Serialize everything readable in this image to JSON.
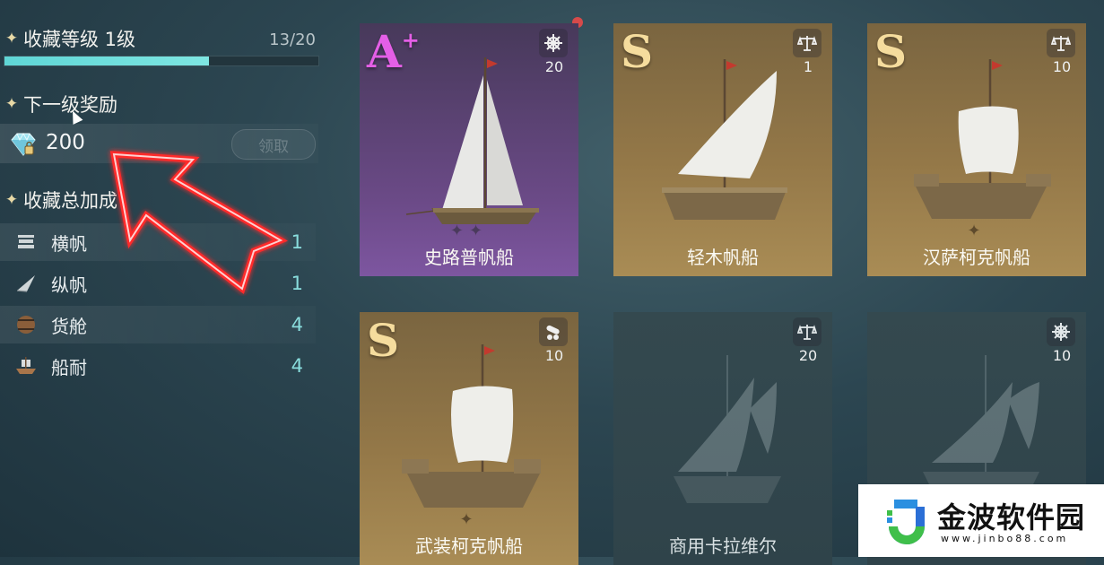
{
  "collection": {
    "level_title": "收藏等级 1级",
    "progress_text": "13/20",
    "progress_fraction": 0.65
  },
  "reward": {
    "title": "下一级奖励",
    "amount": "200",
    "claim_label": "领取"
  },
  "bonus": {
    "title": "收藏总加成",
    "items": [
      {
        "label": "横帆",
        "value": "1",
        "icon": "square-sail-icon"
      },
      {
        "label": "纵帆",
        "value": "1",
        "icon": "lateen-sail-icon"
      },
      {
        "label": "货舱",
        "value": "4",
        "icon": "barrel-icon"
      },
      {
        "label": "船耐",
        "value": "4",
        "icon": "ship-hull-icon"
      }
    ]
  },
  "ships": [
    {
      "name": "史路普帆船",
      "grade": "A",
      "grade_suffix": "+",
      "trait_icon": "helm-wheel-icon",
      "trait_value": "20",
      "rarity": "purple"
    },
    {
      "name": "轻木帆船",
      "grade": "S",
      "grade_suffix": "",
      "trait_icon": "scales-icon",
      "trait_value": "1",
      "rarity": "gold"
    },
    {
      "name": "汉萨柯克帆船",
      "grade": "S",
      "grade_suffix": "",
      "trait_icon": "scales-icon",
      "trait_value": "10",
      "rarity": "gold"
    },
    {
      "name": "武装柯克帆船",
      "grade": "S",
      "grade_suffix": "",
      "trait_icon": "cannon-icon",
      "trait_value": "10",
      "rarity": "gold"
    },
    {
      "name": "商用卡拉维尔",
      "grade": "",
      "grade_suffix": "",
      "trait_icon": "scales-icon",
      "trait_value": "20",
      "rarity": "locked"
    },
    {
      "name": "",
      "grade": "",
      "grade_suffix": "",
      "trait_icon": "helm-wheel-icon",
      "trait_value": "10",
      "rarity": "locked"
    }
  ],
  "watermark": {
    "title": "金波软件园",
    "url": "www.jinbo88.com"
  },
  "colors": {
    "accent": "#7ee6e2",
    "gold": "#f5dc9d",
    "aplus": "#e45fe6",
    "arrow": "#ff2a2a"
  }
}
